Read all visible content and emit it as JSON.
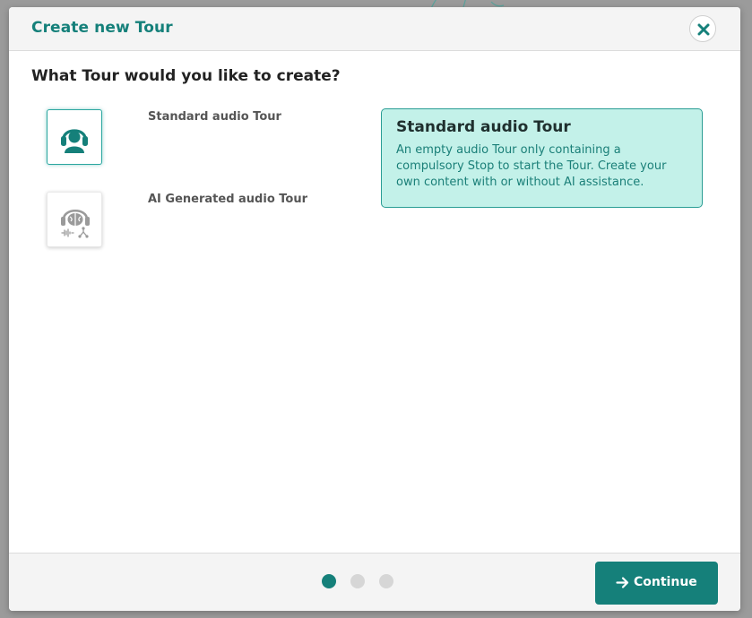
{
  "modal": {
    "title": "Create new Tour",
    "close_icon": "close-x-icon"
  },
  "question": "What Tour would you like to create?",
  "options": [
    {
      "label": "Standard audio Tour",
      "icon": "person-headphones-icon",
      "selected": true
    },
    {
      "label": "AI Generated audio Tour",
      "icon": "ai-brain-headphones-icon",
      "selected": false
    }
  ],
  "description": {
    "title": "Standard audio Tour",
    "text": "An empty audio Tour only containing a compulsory Stop to start the Tour. Create your own content with or without AI assistance."
  },
  "footer": {
    "steps": {
      "current": 1,
      "total": 3
    },
    "continue_label": "Continue",
    "continue_icon": "arrow-right-icon"
  },
  "colors": {
    "accent": "#15807a",
    "card_bg": "#c3f1e9",
    "card_border": "#2a9d94",
    "inactive_dot": "#d6d6d6"
  }
}
